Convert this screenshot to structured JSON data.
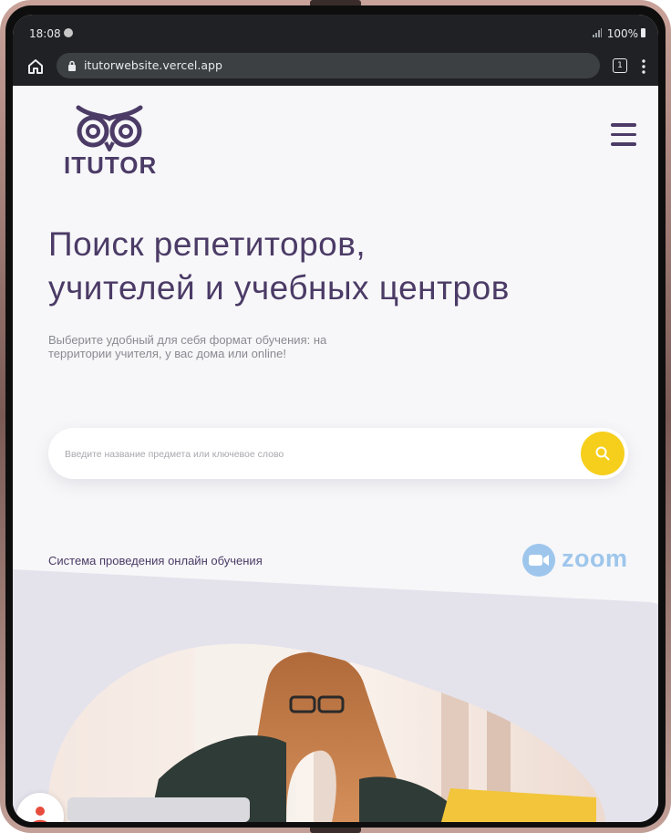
{
  "status_bar": {
    "time": "18:08",
    "battery": "100%"
  },
  "browser": {
    "url": "itutorwebsite.vercel.app",
    "tab_count": "1"
  },
  "header": {
    "logo_text": "ITUTOR"
  },
  "hero": {
    "title_line1": "Поиск репетиторов,",
    "title_line2": "учителей и учебных центров",
    "subtitle": "Выберите удобный для себя формат обучения: на территории учителя, у вас дома или online!"
  },
  "search": {
    "placeholder": "Введите название предмета или ключевое слово",
    "value": ""
  },
  "online_section": {
    "label": "Система проведения онлайн обучения",
    "partner": "zoom"
  },
  "colors": {
    "brand": "#4b3b66",
    "accent": "#f6cf1c",
    "zoom": "#9ec6ec",
    "browser_chrome": "#202124"
  },
  "icons": [
    "home-icon",
    "lock-icon",
    "menu-dots-icon",
    "hamburger-icon",
    "owl-logo-icon",
    "search-icon",
    "zoom-camera-icon",
    "user-icon"
  ]
}
